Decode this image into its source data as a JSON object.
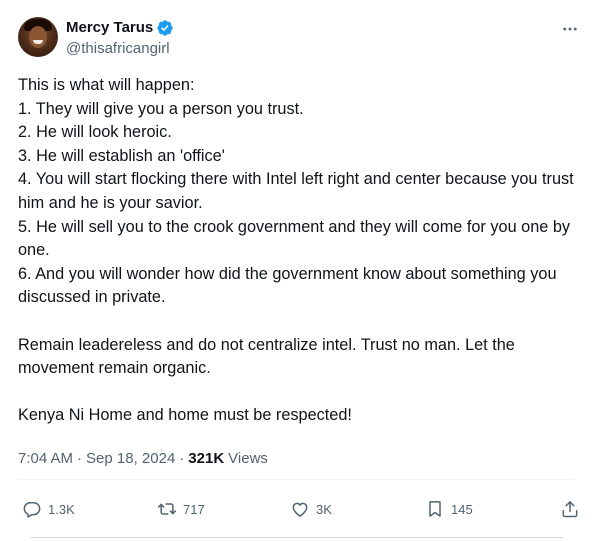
{
  "author": {
    "display_name": "Mercy Tarus",
    "handle": "@thisafricangirl"
  },
  "tweet": {
    "text": "This is what will happen:\n1. They will give you a person you trust.\n2. He will look heroic.\n3. He will establish an 'office'\n4. You will start flocking there with Intel left right and center because you trust him and he is your savior.\n5. He will sell you to the crook government and they will come for you one by one.\n6. And you will wonder how did the government know about something you discussed in private.\n\nRemain leadereless and do not centralize intel. Trust no man. Let the movement remain organic.\n\nKenya Ni Home and home must be respected!"
  },
  "meta": {
    "time": "7:04 AM",
    "dot1": "·",
    "date": "Sep 18, 2024",
    "dot2": "·",
    "views_count": "321K",
    "views_label": "Views"
  },
  "actions": {
    "replies": "1.3K",
    "reposts": "717",
    "likes": "3K",
    "bookmarks": "145"
  },
  "colors": {
    "text_primary": "#0f1419",
    "text_secondary": "#536471",
    "verified_blue": "#1d9bf0",
    "divider": "#eff3f4"
  },
  "icons": {
    "verified": "verified-badge-icon",
    "more": "more-horizontal-icon",
    "reply": "reply-bubble-icon",
    "repost": "repost-arrows-icon",
    "like": "heart-icon",
    "bookmark": "bookmark-icon",
    "share": "share-upload-icon"
  }
}
